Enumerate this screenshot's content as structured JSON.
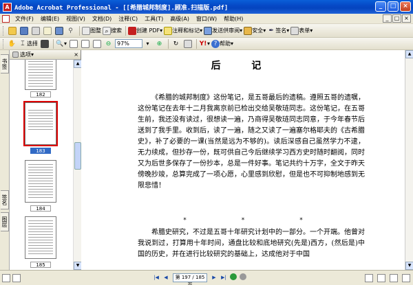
{
  "window": {
    "title": "Adobe Acrobat Professional - [[希腊城邦制度].顾准.扫描版.pdf]",
    "minimize": "_",
    "maximize": "□",
    "close": "×"
  },
  "menu": {
    "items": [
      "文件(F)",
      "编辑(E)",
      "视图(V)",
      "文档(D)",
      "注释(C)",
      "工具(T)",
      "高级(A)",
      "窗口(W)",
      "帮助(H)"
    ],
    "mdi_minimize": "_",
    "mdi_restore": "□",
    "mdi_close": "×"
  },
  "toolbar1": {
    "organizer_label": "图整",
    "search_label": "搜索",
    "create_pdf_label": "创建 PDF",
    "comment_label": "注释和标记",
    "review_label": "发送供审阅",
    "secure_label": "安全",
    "sign_label": "签名",
    "forms_label": "表单"
  },
  "toolbar2": {
    "select_label": "选择",
    "zoom_value": "97%",
    "help_label": "帮助"
  },
  "side_tabs": {
    "bookmarks": "书签",
    "signatures": "签名",
    "layers": "图层"
  },
  "thumbnail_pane": {
    "options_label": "选项",
    "close": "×",
    "pages": [
      {
        "label": "182",
        "selected": false
      },
      {
        "label": "183",
        "selected": true
      },
      {
        "label": "184",
        "selected": false
      },
      {
        "label": "185",
        "selected": false
      }
    ]
  },
  "document": {
    "title": "后 记",
    "paragraph1": "《希腊的城邦制度》这份笔记，是五哥最后的遗稿。遵照五哥的遗嘱，这份笔记在去年十二月我离京前已检出交给吴敬琏同志。这份笔记，在五哥生前，我还没有读过，很想读一遍，乃商得吴敬琏同志同意，于今年春节后送到了我手里。收到后，读了一遍，随之又读了一遍塞尔格耶夫的《古希腊史》，补了必要的一课(当然是远为不够的)。读后深感自己虽然学力不逮，无力续成，但抄存一份，既可供自己今后继续学习西方史时随时翻阅，同时又为后世多保存了一份抄本，总是一件好事。笔记共约十万字，全文于昨天傍晚抄竣，总算完成了一项心愿，心里感到欣慰，但是也不可抑制地感到无限悲惜！",
    "separator": "*",
    "paragraph2": "希腊史研究，不过是五哥十年研究计划中的一部分。一个开端。他曾对我说到过，打算用十年时间，通盘比较和底地研究(先是)西方，(然后是)中国的历史，并在进行比较研究的基础上，达成他对于中国"
  },
  "statusbar": {
    "page_indicator": "第 197 / 185 页",
    "first": "|◀",
    "prev": "◀",
    "next": "▶",
    "last": "▶|"
  }
}
